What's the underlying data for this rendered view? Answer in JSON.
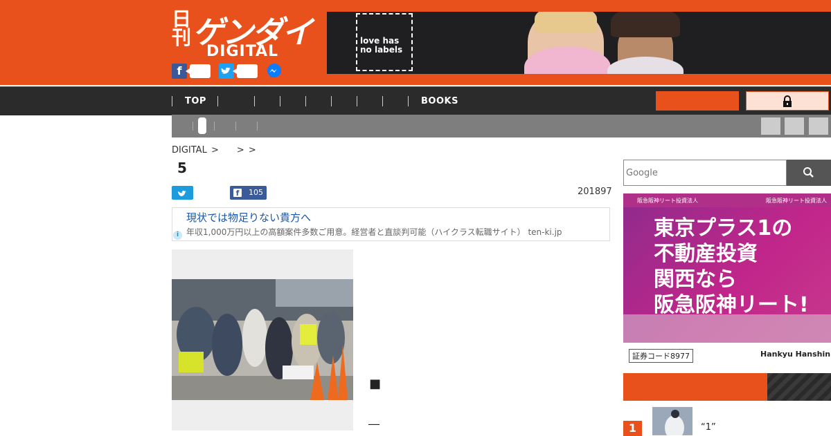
{
  "header": {
    "logo": {
      "nikkan": "日刊",
      "main": "ゲンダイ",
      "sub": "DIGITAL"
    },
    "social": [
      {
        "name": "facebook",
        "icon": "facebook-icon",
        "color": "#3b5998"
      },
      {
        "name": "twitter",
        "icon": "twitter-icon",
        "color": "#1da1f2"
      },
      {
        "name": "messenger",
        "icon": "messenger-icon",
        "color": "#0084ff"
      }
    ],
    "banner_ad": {
      "text": "love has no labels"
    }
  },
  "nav": {
    "items": [
      "TOP",
      "",
      "",
      "",
      "",
      "",
      "",
      "",
      "BOOKS"
    ],
    "login_icon": "lock-icon"
  },
  "breadcrumb": {
    "text": "DIGITAL >　　> >"
  },
  "article": {
    "title": "5",
    "date": "201897",
    "facebook_count": "105",
    "body_square": "■",
    "body_dash": "―"
  },
  "text_ad": {
    "title": "現状では物足りない貴方へ",
    "description": "年収1,000万円以上の高額案件多数ご用意。経営者と直談判可能（ハイクラス転職サイト） ten-ki.jp",
    "info_icon": "info-icon"
  },
  "sidebar": {
    "search": {
      "placeholder": "Google"
    },
    "rect_ad": {
      "header": "阪急阪神リート投資法人",
      "header_left": "阪急阪神リート投資法人",
      "copy_lines": [
        "東京プラス1の",
        "不動産投資",
        "関西なら",
        "阪急阪神リート!"
      ],
      "code": "証券コード8977",
      "brand": "Hankyu Hanshin REIT"
    },
    "ranking": [
      {
        "rank": "1",
        "title": "“1”"
      }
    ]
  },
  "colors": {
    "brand_orange": "#e8501c",
    "nav_dark": "#2b2b2b",
    "subnav_gray": "#7e7e7e"
  }
}
